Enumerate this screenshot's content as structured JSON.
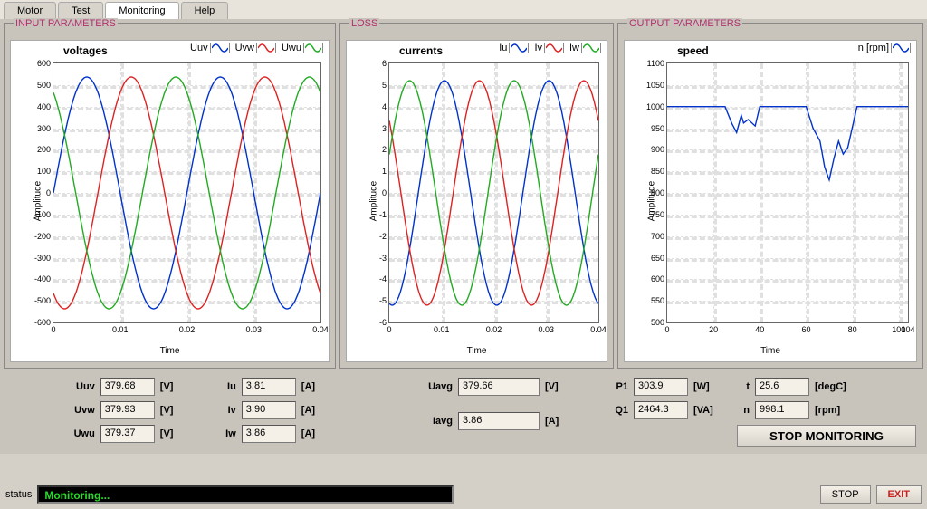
{
  "tabs": {
    "motor": "Motor",
    "test": "Test",
    "monitoring": "Monitoring",
    "help": "Help",
    "active": "Monitoring"
  },
  "panels": {
    "input": "INPUT PARAMETERS",
    "loss": "LOSS",
    "output": "OUTPUT PARAMETERS"
  },
  "charts": {
    "voltages": {
      "title": "voltages",
      "ylabel": "Amplitude",
      "xlabel": "Time",
      "legend": [
        "Uuv",
        "Uvw",
        "Uwu"
      ]
    },
    "currents": {
      "title": "currents",
      "ylabel": "Amplitude",
      "xlabel": "Time",
      "legend": [
        "Iu",
        "Iv",
        "Iw"
      ]
    },
    "speed": {
      "title": "speed",
      "ylabel": "Amplitude",
      "xlabel": "Time",
      "legend": [
        "n [rpm]"
      ]
    }
  },
  "chart_data": [
    {
      "id": "voltages",
      "type": "line",
      "title": "voltages",
      "xlabel": "Time",
      "ylabel": "Amplitude",
      "x_range": [
        0,
        0.04
      ],
      "y_range": [
        -600,
        600
      ],
      "x_ticks": [
        0,
        0.01,
        0.02,
        0.03,
        0.04
      ],
      "y_ticks": [
        -600,
        -500,
        -400,
        -300,
        -200,
        -100,
        0,
        100,
        200,
        300,
        400,
        500,
        600
      ],
      "series": [
        {
          "name": "Uuv",
          "color": "#0033cc",
          "form": "sine",
          "amplitude": 537,
          "period": 0.02,
          "phase": 0
        },
        {
          "name": "Uvw",
          "color": "#dd2222",
          "form": "sine",
          "amplitude": 537,
          "period": 0.02,
          "phase": -120
        },
        {
          "name": "Uwu",
          "color": "#22aa22",
          "form": "sine",
          "amplitude": 537,
          "period": 0.02,
          "phase": 120
        }
      ]
    },
    {
      "id": "currents",
      "type": "line",
      "title": "currents",
      "xlabel": "Time",
      "ylabel": "Amplitude",
      "x_range": [
        0,
        0.04
      ],
      "y_range": [
        -6,
        6
      ],
      "x_ticks": [
        0,
        0.01,
        0.02,
        0.03,
        0.04
      ],
      "y_ticks": [
        -6,
        -5,
        -4,
        -3,
        -2,
        -1,
        0,
        1,
        2,
        3,
        4,
        5,
        6
      ],
      "series": [
        {
          "name": "Iu",
          "color": "#0033cc",
          "form": "sine",
          "amplitude": 5.2,
          "period": 0.02,
          "phase": -100
        },
        {
          "name": "Iv",
          "color": "#dd2222",
          "form": "sine",
          "amplitude": 5.2,
          "period": 0.02,
          "phase": 140
        },
        {
          "name": "Iw",
          "color": "#22aa22",
          "form": "sine",
          "amplitude": 5.2,
          "period": 0.02,
          "phase": 20
        }
      ]
    },
    {
      "id": "speed",
      "type": "line",
      "title": "speed",
      "xlabel": "Time",
      "ylabel": "Amplitude",
      "x_range": [
        0,
        104
      ],
      "y_range": [
        500,
        1100
      ],
      "x_ticks": [
        0,
        20,
        40,
        60,
        80,
        100,
        104
      ],
      "y_ticks": [
        500,
        550,
        600,
        650,
        700,
        750,
        800,
        850,
        900,
        950,
        1000,
        1050,
        1100
      ],
      "series": [
        {
          "name": "n [rpm]",
          "color": "#0033cc",
          "x": [
            0,
            25,
            28,
            30,
            32,
            33,
            35,
            38,
            40,
            45,
            55,
            60,
            63,
            66,
            68,
            70,
            72,
            74,
            76,
            78,
            82,
            104
          ],
          "y": [
            1000,
            1000,
            960,
            940,
            980,
            962,
            970,
            955,
            1000,
            1000,
            1000,
            1000,
            950,
            920,
            860,
            830,
            880,
            920,
            890,
            905,
            1000,
            1000
          ]
        }
      ]
    }
  ],
  "readouts": {
    "Uuv": {
      "label": "Uuv",
      "value": "379.68",
      "unit": "[V]"
    },
    "Uvw": {
      "label": "Uvw",
      "value": "379.93",
      "unit": "[V]"
    },
    "Uwu": {
      "label": "Uwu",
      "value": "379.37",
      "unit": "[V]"
    },
    "Iu": {
      "label": "Iu",
      "value": "3.81",
      "unit": "[A]"
    },
    "Iv": {
      "label": "Iv",
      "value": "3.90",
      "unit": "[A]"
    },
    "Iw": {
      "label": "Iw",
      "value": "3.86",
      "unit": "[A]"
    },
    "Uavg": {
      "label": "Uavg",
      "value": "379.66",
      "unit": "[V]"
    },
    "Iavg": {
      "label": "Iavg",
      "value": "3.86",
      "unit": "[A]"
    },
    "P1": {
      "label": "P1",
      "value": "303.9",
      "unit": "[W]"
    },
    "Q1": {
      "label": "Q1",
      "value": "2464.3",
      "unit": "[VA]"
    },
    "t": {
      "label": "t",
      "value": "25.6",
      "unit": "[degC]"
    },
    "n": {
      "label": "n",
      "value": "998.1",
      "unit": "[rpm]"
    }
  },
  "buttons": {
    "stop_monitoring": "STOP MONITORING",
    "stop": "STOP",
    "exit": "EXIT"
  },
  "status": {
    "label": "status",
    "value": "Monitoring..."
  }
}
